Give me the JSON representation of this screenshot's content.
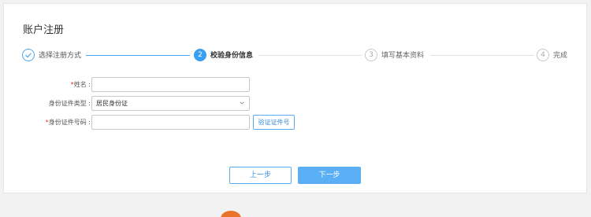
{
  "card": {
    "title": "账户注册"
  },
  "steps": [
    {
      "number": "✓",
      "label": "选择注册方式",
      "state": "done"
    },
    {
      "number": "2",
      "label": "校验身份信息",
      "state": "active"
    },
    {
      "number": "3",
      "label": "填写基本资料",
      "state": "todo"
    },
    {
      "number": "4",
      "label": "完成",
      "state": "todo"
    }
  ],
  "form": {
    "name": {
      "required_mark": "*",
      "label": "姓名 :",
      "value": ""
    },
    "id_type": {
      "label": "身份证件类型 :",
      "value": "居民身份证"
    },
    "id_number": {
      "required_mark": "*",
      "label": "身份证件号码 :",
      "value": ""
    },
    "verify_label": "验证证件号"
  },
  "actions": {
    "prev_label": "上一步",
    "next_label": "下一步"
  },
  "colors": {
    "accent": "#3a9ff0",
    "required": "#e53935"
  }
}
